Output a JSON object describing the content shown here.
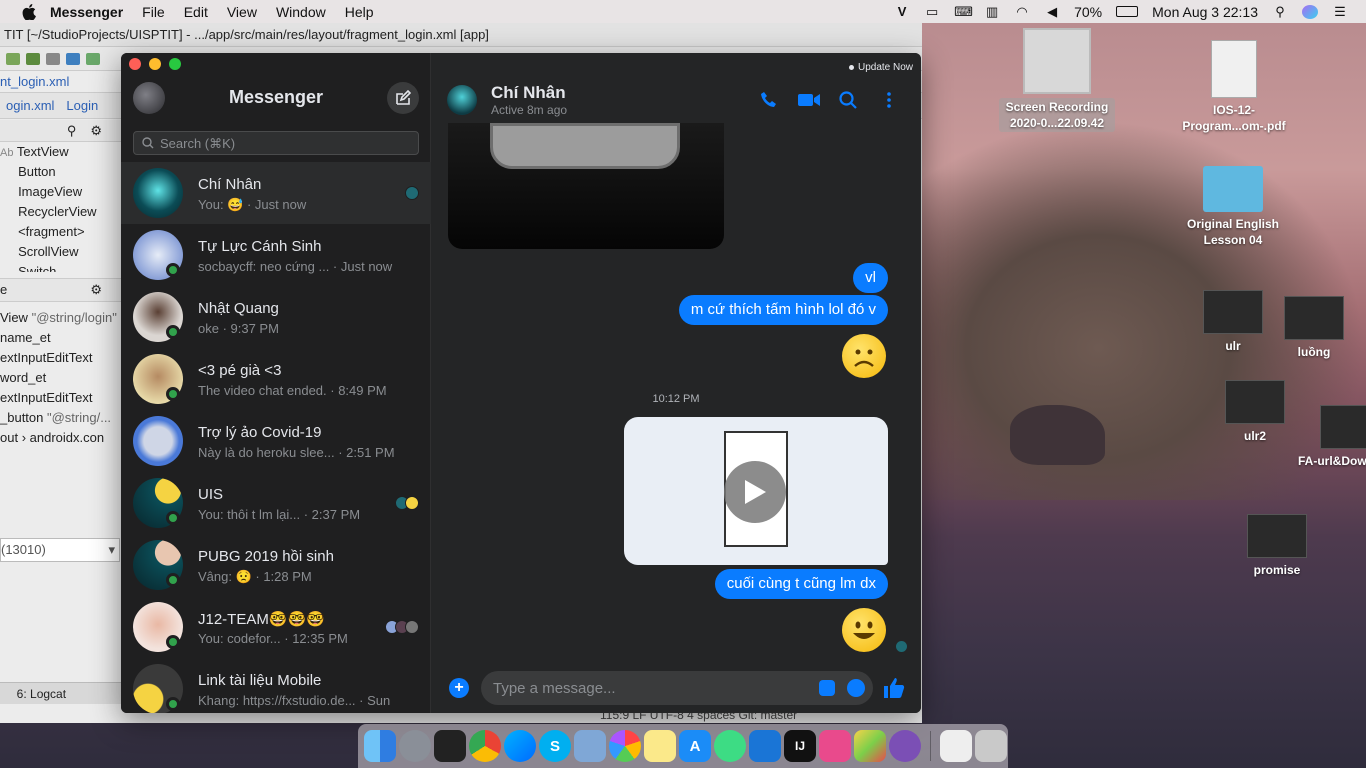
{
  "menubar": {
    "app": "Messenger",
    "items": [
      "File",
      "Edit",
      "View",
      "Window",
      "Help"
    ],
    "battery": "70%",
    "datetime": "Mon Aug 3  22:13"
  },
  "ide": {
    "title": "TIT [~/StudioProjects/UISPTIT] - .../app/src/main/res/layout/fragment_login.xml [app]",
    "crumb": "nt_login.xml",
    "tabs": [
      "ogin.xml",
      "Login"
    ],
    "palette": [
      "TextView",
      "Button",
      "ImageView",
      "RecyclerView",
      "<fragment>",
      "ScrollView",
      "Switch"
    ],
    "palette_prefix": "Ab",
    "tree": [
      {
        "label": "View",
        "value": "\"@string/login\""
      },
      {
        "label": "name_et",
        "value": ""
      },
      {
        "label": "extInputEditText",
        "value": ""
      },
      {
        "label": "word_et",
        "value": ""
      },
      {
        "label": "extInputEditText",
        "value": ""
      },
      {
        "label": "_button",
        "value": "\"@string/..."
      },
      {
        "label": "out",
        "value": "androidx.con"
      }
    ],
    "tree_header": "e",
    "combo": "(13010)",
    "bottom_tab": "6: Logcat",
    "status": "115:9   LF   UTF-8   4 spaces   Git: master"
  },
  "messenger": {
    "title": "Messenger",
    "search_placeholder": "Search (⌘K)",
    "conversations": [
      {
        "name": "Chí Nhân",
        "preview": "You: 😅 · Just now",
        "online": false,
        "active": true
      },
      {
        "name": "Tự Lực Cánh Sinh",
        "preview": "socbaycff: neo cứng ... · Just now",
        "online": true
      },
      {
        "name": "Nhật Quang",
        "preview": "oke · 9:37 PM",
        "online": true
      },
      {
        "name": "<3 pé già <3",
        "preview": "The video chat ended. · 8:49 PM",
        "online": true
      },
      {
        "name": "Trợ lý ảo Covid-19",
        "preview": "Này là do heroku slee...  · 2:51 PM",
        "online": false
      },
      {
        "name": "UIS",
        "preview": "You: thôi t lm lại... · 2:37 PM",
        "online": true
      },
      {
        "name": "PUBG 2019 hồi sinh",
        "preview": "Vâng: 😟 · 1:28 PM",
        "online": true
      },
      {
        "name": "J12-TEAM🤓🤓🤓",
        "preview": "You: codefor... · 12:35 PM",
        "online": true
      },
      {
        "name": "Link tài liệu Mobile",
        "preview": "Khang: https://fxstudio.de... · Sun",
        "online": true
      }
    ],
    "chat": {
      "update_now": "Update Now",
      "contact_name": "Chí Nhân",
      "status": "Active 8m ago",
      "messages": [
        "vl",
        "m cứ thích tấm hình lol đó v",
        "cuối cùng t cũng lm dx"
      ],
      "timestamp": "10:12 PM",
      "composer_placeholder": "Type a message..."
    }
  },
  "desktop": {
    "icons": [
      {
        "label": "Screen Recording 2020-0...22.09.42"
      },
      {
        "label": "IOS-12-Program...om-.pdf"
      },
      {
        "label": "Original English Lesson 04"
      },
      {
        "label": "ulr"
      },
      {
        "label": "luồng"
      },
      {
        "label": "ulr2"
      },
      {
        "label": "FA-url&Dow"
      },
      {
        "label": "promise"
      }
    ]
  },
  "colors": {
    "accent": "#0a7cff",
    "online": "#31a24c",
    "sidebar": "#1f1f20",
    "chat_bg": "#242526"
  }
}
